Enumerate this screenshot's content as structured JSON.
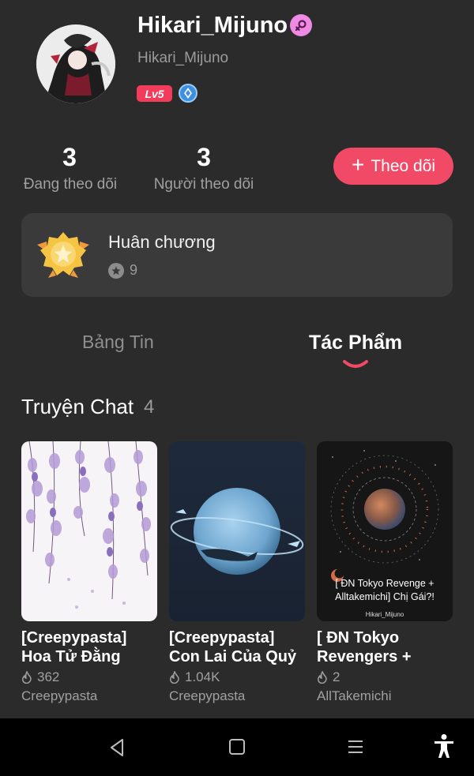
{
  "profile": {
    "username": "Hikari_Mijuno",
    "handle": "Hikari_Mijuno",
    "level": "Lv5",
    "gender_icon": "female-symbol-icon",
    "badge_icon": "verified-badge-icon"
  },
  "stats": [
    {
      "value": "3",
      "label": "Đang theo dõi"
    },
    {
      "value": "3",
      "label": "Người theo dõi"
    }
  ],
  "follow_button": {
    "label": "Theo dõi"
  },
  "medals": {
    "title": "Huân chương",
    "count": "9"
  },
  "tabs": [
    {
      "label": "Bảng Tin",
      "active": false
    },
    {
      "label": "Tác Phẩm",
      "active": true
    }
  ],
  "section": {
    "title": "Truyện Chat",
    "count": "4"
  },
  "works": [
    {
      "title": "[Creepypasta]\nHoa Tử Đằng",
      "views": "362",
      "tag": "Creepypasta"
    },
    {
      "title": "[Creepypasta]\nCon Lai Của Quỷ",
      "views": "1.04K",
      "tag": "Creepypasta"
    },
    {
      "title": "[ ĐN Tokyo\nRevengers + Allt…",
      "views": "2",
      "tag": "AllTakemichi",
      "cover_text": "[ ĐN Tokyo Revenge + Alltakemichi] Chị Gái?!",
      "cover_author": "Hikari_Mijuno"
    }
  ],
  "colors": {
    "accent": "#f14a67",
    "background": "#2b2b2b",
    "card": "#3a3a3a"
  }
}
